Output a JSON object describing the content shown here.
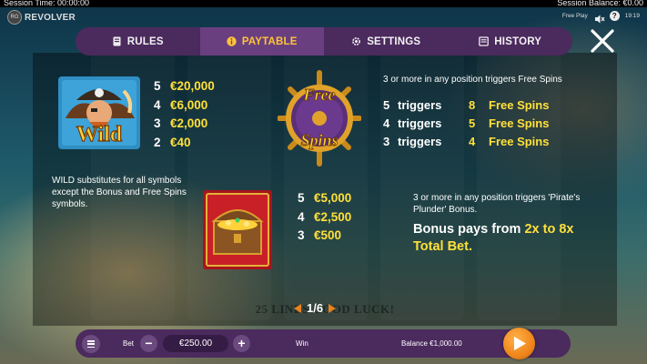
{
  "status_bar": {
    "session_time": "Session Time: 00:00:00",
    "session_balance": "Session Balance: €0.00",
    "free_play": "Free Play",
    "clock": "19:19"
  },
  "logo": {
    "badge": "RG",
    "text": "REVOLVER"
  },
  "tabs": [
    {
      "label": "RULES",
      "icon": "book-icon",
      "active": false
    },
    {
      "label": "PAYTABLE",
      "icon": "info-icon",
      "active": true
    },
    {
      "label": "SETTINGS",
      "icon": "gear-icon",
      "active": false
    },
    {
      "label": "HISTORY",
      "icon": "history-icon",
      "active": false
    }
  ],
  "wild": {
    "symbol_text": "Wild",
    "pays": [
      {
        "count": "5",
        "value": "€20,000"
      },
      {
        "count": "4",
        "value": "€6,000"
      },
      {
        "count": "3",
        "value": "€2,000"
      },
      {
        "count": "2",
        "value": "€40"
      }
    ],
    "description": "WILD substitutes for all symbols except the Bonus and Free Spins symbols."
  },
  "free_spins": {
    "symbol_text_top": "Free",
    "symbol_text_bottom": "Spins",
    "intro": "3 or more in any position triggers Free Spins",
    "rows": [
      {
        "count": "5",
        "triggers": "triggers",
        "spins": "8",
        "label": "Free Spins"
      },
      {
        "count": "4",
        "triggers": "triggers",
        "spins": "5",
        "label": "Free Spins"
      },
      {
        "count": "3",
        "triggers": "triggers",
        "spins": "4",
        "label": "Free Spins"
      }
    ]
  },
  "bonus": {
    "pays": [
      {
        "count": "5",
        "value": "€5,000"
      },
      {
        "count": "4",
        "value": "€2,500"
      },
      {
        "count": "3",
        "value": "€500"
      }
    ],
    "intro": "3 or more in any position triggers 'Pirate's Plunder' Bonus.",
    "line_prefix": "Bonus pays from ",
    "line_range": "2x to 8x",
    "line_suffix": "Total Bet."
  },
  "background_text": "25 LINES GOOD LUCK!",
  "pager": {
    "label": "1/6"
  },
  "bottom_bar": {
    "bet_label": "Bet",
    "bet_value": "€250.00",
    "minus": "−",
    "plus": "+",
    "win_label": "Win",
    "balance_label": "Balance",
    "balance_value": "€1,000.00"
  },
  "colors": {
    "panel": "#4b2a5e",
    "active_tab": "#6a3f80",
    "accent_yellow": "#ffe03a",
    "active_tab_text": "#ffc43a",
    "play_orange": "#f0861b"
  }
}
